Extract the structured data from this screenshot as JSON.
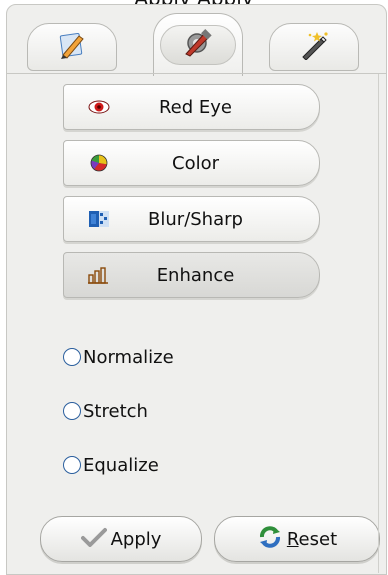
{
  "title_fragment": "Apply  Apply",
  "tabs": [
    {
      "icon": "pencil-edit-icon",
      "active": false
    },
    {
      "icon": "tools-icon",
      "active": true
    },
    {
      "icon": "magic-wand-icon",
      "active": false
    }
  ],
  "tools": [
    {
      "label": "Red Eye",
      "icon": "red-eye-icon",
      "selected": false
    },
    {
      "label": "Color",
      "icon": "color-wheel-icon",
      "selected": false
    },
    {
      "label": "Blur/Sharp",
      "icon": "blur-sharp-icon",
      "selected": false
    },
    {
      "label": "Enhance",
      "icon": "enhance-icon",
      "selected": true
    }
  ],
  "options": [
    {
      "label": "Normalize",
      "checked": false
    },
    {
      "label": "Stretch",
      "checked": false
    },
    {
      "label": "Equalize",
      "checked": false
    }
  ],
  "actions": {
    "apply_label": "Apply",
    "reset_first": "R",
    "reset_rest": "eset"
  },
  "colors": {
    "panel": "#efefed",
    "border": "#c8c8c4",
    "radio_border": "#2b5f9e"
  }
}
